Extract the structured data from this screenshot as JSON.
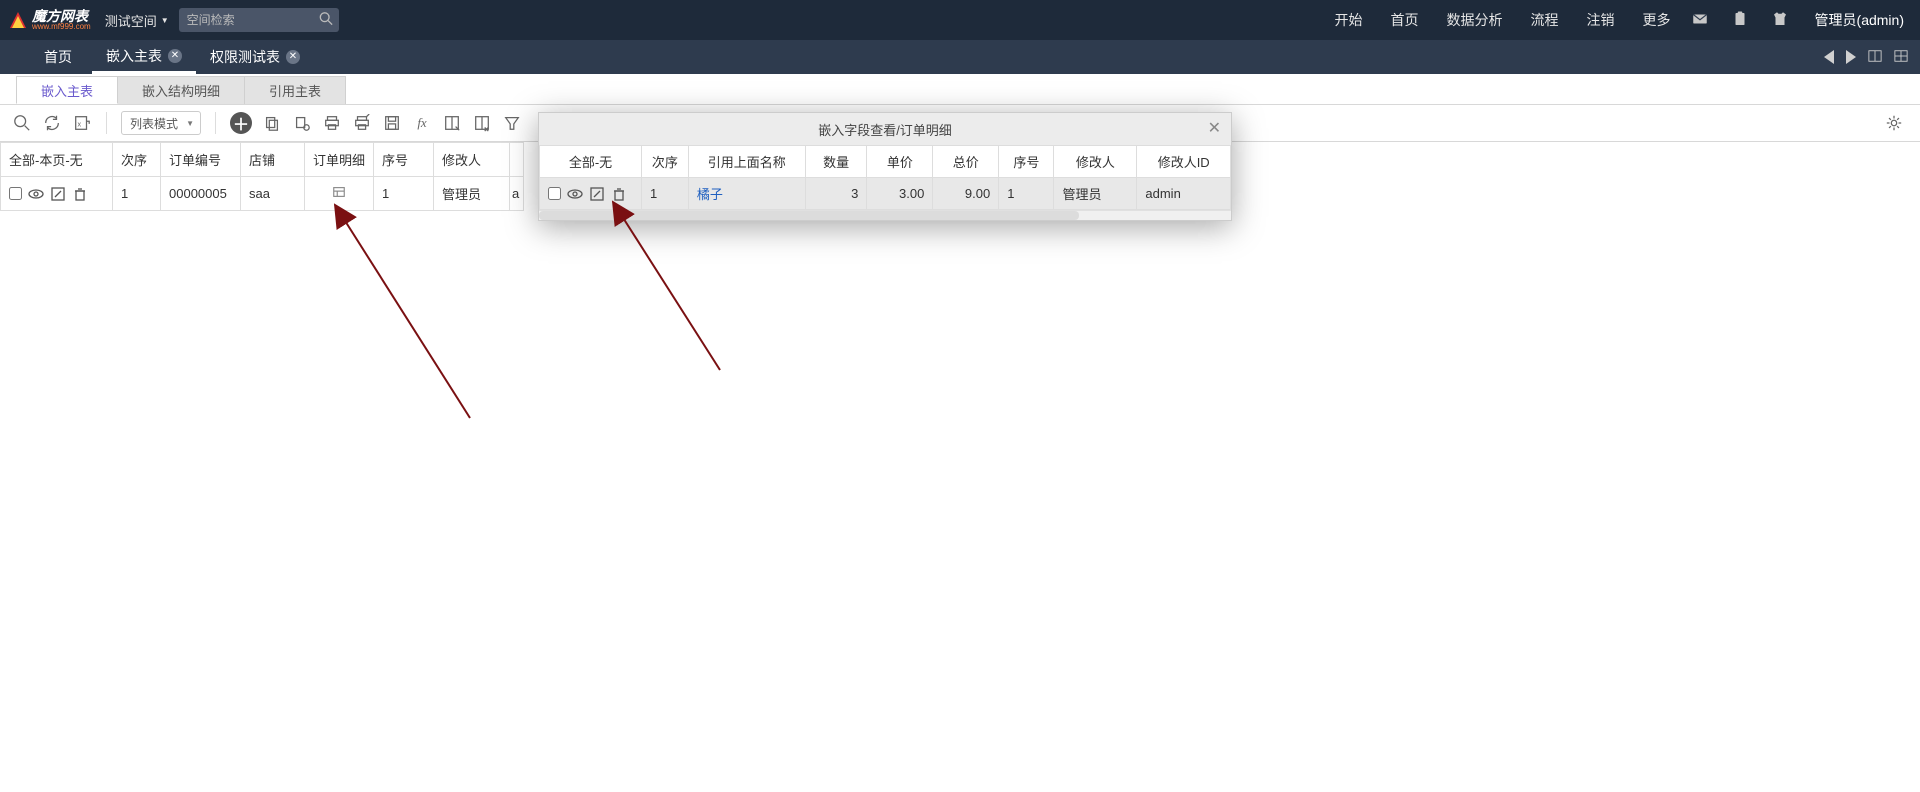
{
  "brand": {
    "cn": "魔方网表",
    "en": "www.mf999.com"
  },
  "space": {
    "label": "测试空间"
  },
  "search": {
    "placeholder": "空间检索"
  },
  "topmenu": [
    "开始",
    "首页",
    "数据分析",
    "流程",
    "注销",
    "更多"
  ],
  "user": {
    "label": "管理员(admin)"
  },
  "doc_tabs": {
    "home": "首页",
    "items": [
      {
        "label": "嵌入主表",
        "active": true
      },
      {
        "label": "权限测试表",
        "active": false
      }
    ]
  },
  "sub_tabs": [
    "嵌入主表",
    "嵌入结构明细",
    "引用主表"
  ],
  "mode_select": "列表模式",
  "main_table": {
    "headers": [
      "全部-本页-无",
      "次序",
      "订单编号",
      "店铺",
      "订单明细",
      "序号",
      "修改人",
      ""
    ],
    "row": {
      "seq": "1",
      "order_no": "00000005",
      "shop": "saa",
      "ord_seq": "1",
      "modifier": "管理员",
      "modifier_id_trunc": "a"
    }
  },
  "popup": {
    "title": "嵌入字段查看/订单明细",
    "headers": [
      "全部-无",
      "次序",
      "引用上面名称",
      "数量",
      "单价",
      "总价",
      "序号",
      "修改人",
      "修改人ID"
    ],
    "row": {
      "seq": "1",
      "ref_name": "橘子",
      "qty": "3",
      "price": "3.00",
      "total": "9.00",
      "ord": "1",
      "modifier": "管理员",
      "modifier_id": "admin"
    }
  }
}
